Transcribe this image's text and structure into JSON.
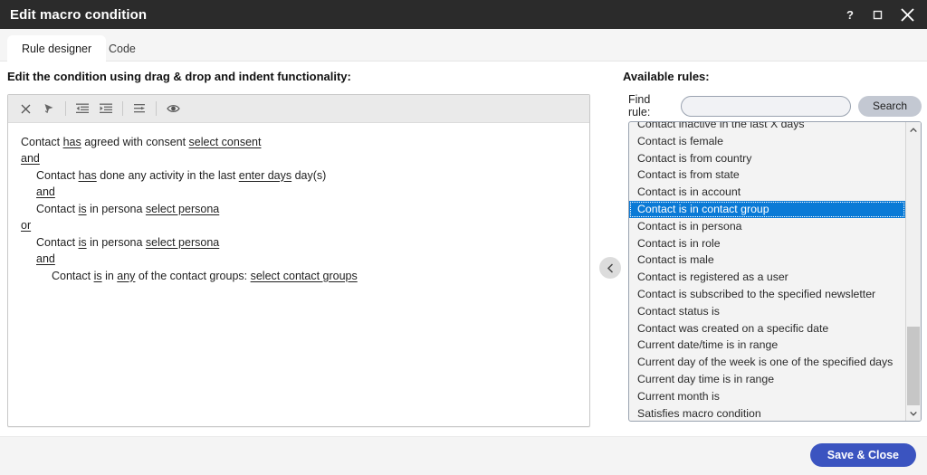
{
  "window": {
    "title": "Edit macro condition",
    "buttons": {
      "help": "?",
      "maximize": "maximize-icon",
      "close": "close-icon"
    }
  },
  "tabs": [
    {
      "label": "Rule designer",
      "active": true
    },
    {
      "label": "Code",
      "active": false
    }
  ],
  "left_pane": {
    "heading": "Edit the condition using drag & drop and indent functionality:",
    "toolbar": [
      {
        "name": "delete-icon",
        "title": "Delete"
      },
      {
        "name": "clear-formatting-icon",
        "title": "Clear"
      },
      {
        "name": "outdent-icon",
        "title": "Outdent"
      },
      {
        "name": "indent-icon",
        "title": "Indent"
      },
      {
        "name": "sort-icon",
        "title": "Sort"
      },
      {
        "name": "preview-eye-icon",
        "title": "Preview"
      }
    ],
    "condition_lines": [
      {
        "indent": 0,
        "parts": [
          {
            "text": "Contact ",
            "style": "plain"
          },
          {
            "text": "has",
            "style": "underline"
          },
          {
            "text": " agreed with consent ",
            "style": "plain"
          },
          {
            "text": "select consent",
            "style": "underline"
          }
        ]
      },
      {
        "indent": 0,
        "parts": [
          {
            "text": "and",
            "style": "underline"
          }
        ]
      },
      {
        "indent": 1,
        "parts": [
          {
            "text": "Contact ",
            "style": "plain"
          },
          {
            "text": "has",
            "style": "underline"
          },
          {
            "text": " done any activity in the last ",
            "style": "plain"
          },
          {
            "text": "enter days",
            "style": "underline"
          },
          {
            "text": " day(s)",
            "style": "plain"
          }
        ]
      },
      {
        "indent": 1,
        "parts": [
          {
            "text": "and",
            "style": "underline"
          }
        ]
      },
      {
        "indent": 1,
        "parts": [
          {
            "text": "Contact ",
            "style": "plain"
          },
          {
            "text": "is",
            "style": "underline"
          },
          {
            "text": " in persona ",
            "style": "plain"
          },
          {
            "text": "select persona",
            "style": "underline"
          }
        ]
      },
      {
        "indent": 0,
        "parts": [
          {
            "text": "or",
            "style": "underline"
          }
        ]
      },
      {
        "indent": 1,
        "parts": [
          {
            "text": "Contact ",
            "style": "plain"
          },
          {
            "text": "is",
            "style": "underline"
          },
          {
            "text": " in persona ",
            "style": "plain"
          },
          {
            "text": "select persona",
            "style": "underline"
          }
        ]
      },
      {
        "indent": 1,
        "parts": [
          {
            "text": "and",
            "style": "underline"
          }
        ]
      },
      {
        "indent": 2,
        "parts": [
          {
            "text": "Contact ",
            "style": "plain"
          },
          {
            "text": "is",
            "style": "underline"
          },
          {
            "text": " in ",
            "style": "plain"
          },
          {
            "text": "any",
            "style": "underline"
          },
          {
            "text": " of the contact groups: ",
            "style": "plain"
          },
          {
            "text": "select contact groups",
            "style": "underline"
          }
        ]
      }
    ]
  },
  "collapse_button": {
    "name": "collapse-left-chevron",
    "glyph": "chevron-left-icon"
  },
  "right_pane": {
    "heading": "Available rules:",
    "find_label": "Find rule:",
    "find_value": "",
    "find_placeholder": "",
    "search_label": "Search",
    "rules": [
      {
        "label": "Contact inactive in the last X days",
        "selected": false
      },
      {
        "label": "Contact is female",
        "selected": false
      },
      {
        "label": "Contact is from country",
        "selected": false
      },
      {
        "label": "Contact is from state",
        "selected": false
      },
      {
        "label": "Contact is in account",
        "selected": false
      },
      {
        "label": "Contact is in contact group",
        "selected": true
      },
      {
        "label": "Contact is in persona",
        "selected": false
      },
      {
        "label": "Contact is in role",
        "selected": false
      },
      {
        "label": "Contact is male",
        "selected": false
      },
      {
        "label": "Contact is registered as a user",
        "selected": false
      },
      {
        "label": "Contact is subscribed to the specified newsletter",
        "selected": false
      },
      {
        "label": "Contact status is",
        "selected": false
      },
      {
        "label": "Contact was created on a specific date",
        "selected": false
      },
      {
        "label": "Current date/time is in range",
        "selected": false
      },
      {
        "label": "Current day of the week is one of the specified days",
        "selected": false
      },
      {
        "label": "Current day time is in range",
        "selected": false
      },
      {
        "label": "Current month is",
        "selected": false
      },
      {
        "label": "Satisfies macro condition",
        "selected": false
      }
    ]
  },
  "footer": {
    "save_label": "Save & Close"
  },
  "colors": {
    "titlebar": "#2b2b2b",
    "accent_button": "#3b54c0",
    "selection": "#0a7ad6",
    "footer": "#f4f4f4"
  }
}
